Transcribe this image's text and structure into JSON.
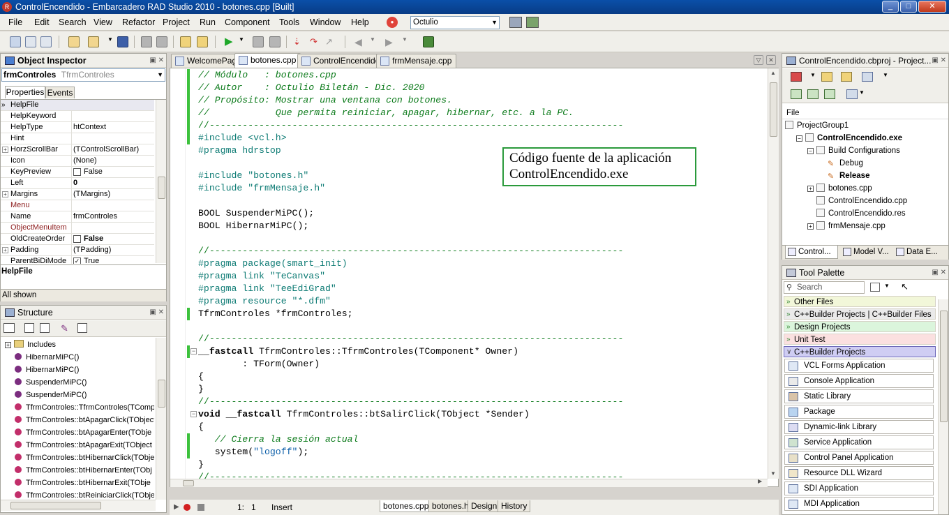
{
  "window": {
    "title": "ControlEncendido - Embarcadero RAD Studio 2010 - botones.cpp [Built]",
    "min": "_",
    "max": "□",
    "close": "✕"
  },
  "menu": [
    "File",
    "Edit",
    "Search",
    "View",
    "Refactor",
    "Project",
    "Run",
    "Component",
    "Tools",
    "Window",
    "Help"
  ],
  "toolbar": {
    "combo_value": "Octulio"
  },
  "object_inspector": {
    "title": "Object Inspector",
    "component": "frmControles",
    "component_type": "TfrmControles",
    "tabs": [
      "Properties",
      "Events"
    ],
    "rows": [
      {
        "name": "HelpFile",
        "value": "",
        "plus": false
      },
      {
        "name": "HelpKeyword",
        "value": "",
        "plus": false
      },
      {
        "name": "HelpType",
        "value": "htContext",
        "plus": false
      },
      {
        "name": "Hint",
        "value": "",
        "plus": false
      },
      {
        "name": "HorzScrollBar",
        "value": "(TControlScrollBar)",
        "plus": true
      },
      {
        "name": "Icon",
        "value": "(None)",
        "plus": false
      },
      {
        "name": "KeyPreview",
        "value": "False",
        "plus": false,
        "check": true
      },
      {
        "name": "Left",
        "value": "0",
        "plus": false,
        "bold": true
      },
      {
        "name": "Margins",
        "value": "(TMargins)",
        "plus": true
      },
      {
        "name": "Menu",
        "value": "",
        "plus": false,
        "red": true
      },
      {
        "name": "Name",
        "value": "frmControles",
        "plus": false
      },
      {
        "name": "ObjectMenuItem",
        "value": "",
        "plus": false,
        "red": true
      },
      {
        "name": "OldCreateOrder",
        "value": "False",
        "plus": false,
        "check": true,
        "bold": true
      },
      {
        "name": "Padding",
        "value": "(TPadding)",
        "plus": true
      },
      {
        "name": "ParentBiDiMode",
        "value": "True",
        "plus": false,
        "check": true,
        "checked": true
      }
    ],
    "help_title": "HelpFile",
    "all_shown": "All shown"
  },
  "structure": {
    "title": "Structure",
    "items": [
      "Includes",
      "HibernarMiPC()",
      "HibernarMiPC()",
      "SuspenderMiPC()",
      "SuspenderMiPC()",
      "TfrmControles::TfrmControles(TComp",
      "TfrmControles::btApagarClick(TObject",
      "TfrmControles::btApagarEnter(TObje",
      "TfrmControles::btApagarExit(TObject",
      "TfrmControles::btHibernarClick(TObje",
      "TfrmControles::btHibernarEnter(TObj",
      "TfrmControles::btHibernarExit(TObje",
      "TfrmControles::btReiniciarClick(TObje"
    ]
  },
  "editor": {
    "tabs": [
      "WelcomePage",
      "botones.cpp",
      "ControlEncendido",
      "frmMensaje.cpp"
    ],
    "active_tab": 1,
    "callout_line1": "Código fuente de la aplicación",
    "callout_line2": "ControlEncendido.exe",
    "status_pos": "1:   1",
    "status_mode": "Insert",
    "bottom_tabs": [
      "botones.cpp",
      "botones.h",
      "Design",
      "History"
    ]
  },
  "code": [
    {
      "t": "cm",
      "s": "// Módulo   : botones.cpp"
    },
    {
      "t": "cm",
      "s": "// Autor    : Octulio Biletán - Dic. 2020"
    },
    {
      "t": "cm",
      "s": "// Propósito: Mostrar una ventana con botones."
    },
    {
      "t": "cm",
      "s": "//            Que permita reiniciar, apagar, hibernar, etc. a la PC."
    },
    {
      "t": "dv",
      "s": "//---------------------------------------------------------------------------"
    },
    {
      "t": "pp",
      "s": "#include <vcl.h>"
    },
    {
      "t": "pp",
      "s": "#pragma hdrstop"
    },
    {
      "t": "pl",
      "s": ""
    },
    {
      "t": "pp",
      "s": "#include \"botones.h\""
    },
    {
      "t": "pp",
      "s": "#include \"frmMensaje.h\""
    },
    {
      "t": "pl",
      "s": ""
    },
    {
      "t": "pl",
      "s": "BOOL SuspenderMiPC();"
    },
    {
      "t": "pl",
      "s": "BOOL HibernarMiPC();"
    },
    {
      "t": "pl",
      "s": ""
    },
    {
      "t": "dv",
      "s": "//---------------------------------------------------------------------------"
    },
    {
      "t": "pp",
      "s": "#pragma package(smart_init)"
    },
    {
      "t": "pp",
      "s": "#pragma link \"TeCanvas\""
    },
    {
      "t": "pp",
      "s": "#pragma link \"TeeEdiGrad\""
    },
    {
      "t": "pp",
      "s": "#pragma resource \"*.dfm\""
    },
    {
      "t": "pl",
      "s": "TfrmControles *frmControles;"
    },
    {
      "t": "pl",
      "s": ""
    },
    {
      "t": "dv",
      "s": "//---------------------------------------------------------------------------"
    },
    {
      "t": "kw",
      "k": "__fastcall",
      "s": " TfrmControles::TfrmControles(TComponent* Owner)"
    },
    {
      "t": "pl",
      "s": "        : TForm(Owner)"
    },
    {
      "t": "pl",
      "s": "{"
    },
    {
      "t": "pl",
      "s": "}"
    },
    {
      "t": "dv",
      "s": "//---------------------------------------------------------------------------"
    },
    {
      "t": "kw",
      "k": "void __fastcall",
      "s": " TfrmControles::btSalirClick(TObject *Sender)"
    },
    {
      "t": "pl",
      "s": "{"
    },
    {
      "t": "cm",
      "s": "   // Cierra la sesión actual"
    },
    {
      "t": "st",
      "p": "   system(",
      "q": "\"logoff\"",
      "e": ");"
    },
    {
      "t": "pl",
      "s": "}"
    },
    {
      "t": "dv",
      "s": "//---------------------------------------------------------------------------"
    }
  ],
  "project_manager": {
    "title": "ControlEncendido.cbproj - Project...",
    "file_label": "File",
    "tree": [
      {
        "label": "ProjectGroup1",
        "indent": 0,
        "bold": false
      },
      {
        "label": "ControlEncendido.exe",
        "indent": 1,
        "bold": true
      },
      {
        "label": "Build Configurations",
        "indent": 2,
        "bold": false
      },
      {
        "label": "Debug",
        "indent": 3,
        "bold": false
      },
      {
        "label": "Release",
        "indent": 3,
        "bold": true
      },
      {
        "label": "botones.cpp",
        "indent": 2,
        "bold": false
      },
      {
        "label": "ControlEncendido.cpp",
        "indent": 2,
        "bold": false
      },
      {
        "label": "ControlEncendido.res",
        "indent": 2,
        "bold": false
      },
      {
        "label": "frmMensaje.cpp",
        "indent": 2,
        "bold": false
      }
    ],
    "bottom_tabs": [
      "Control...",
      "Model V...",
      "Data E..."
    ]
  },
  "tool_palette": {
    "title": "Tool Palette",
    "search_placeholder": "Search",
    "categories": [
      {
        "label": "Other Files",
        "color": "#f2f7d9"
      },
      {
        "label": "C++Builder Projects | C++Builder Files",
        "color": "#eaeaea"
      },
      {
        "label": "Design Projects",
        "color": "#dbf5dc"
      },
      {
        "label": "Unit Test",
        "color": "#fbe0e0"
      },
      {
        "label": "C++Builder Projects",
        "color": "#cfcdf3"
      }
    ],
    "items": [
      "VCL Forms Application",
      "Console Application",
      "Static Library",
      "Package",
      "Dynamic-link Library",
      "Service Application",
      "Control Panel Application",
      "Resource DLL Wizard",
      "SDI Application",
      "MDI Application"
    ]
  }
}
